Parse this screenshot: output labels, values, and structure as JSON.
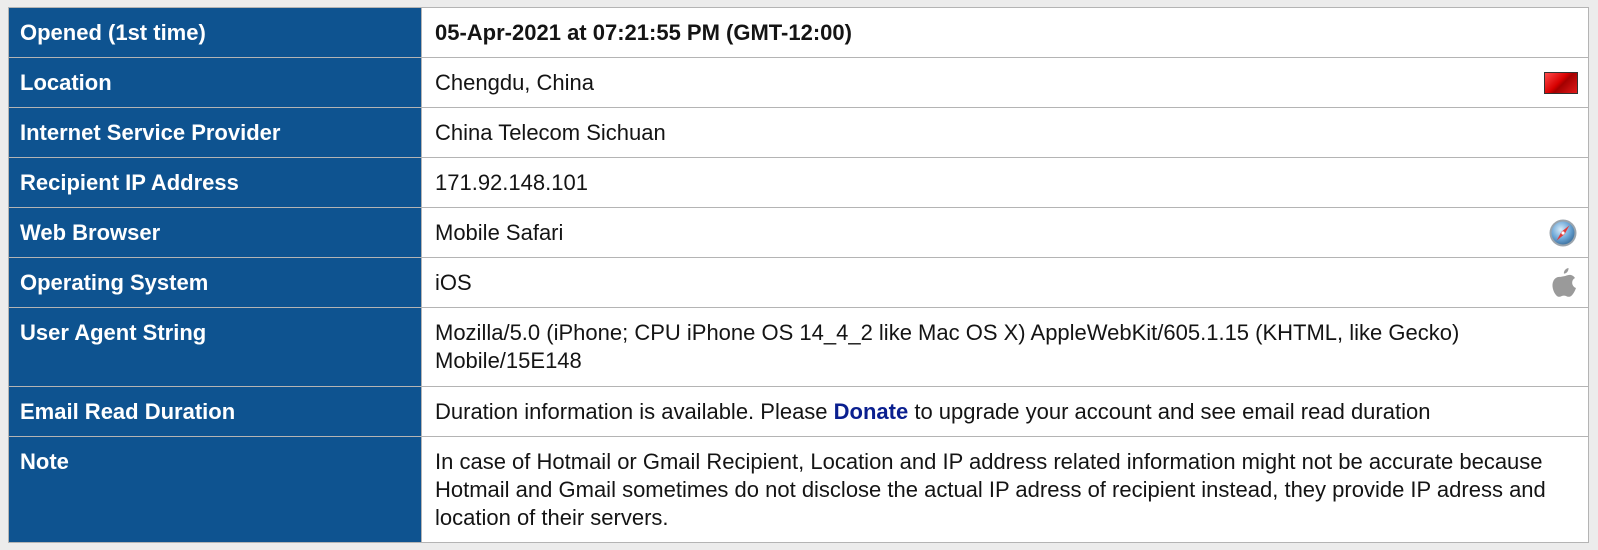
{
  "rows": {
    "opened": {
      "label": "Opened (1st time)",
      "value": "05-Apr-2021 at 07:21:55 PM (GMT-12:00)"
    },
    "location": {
      "label": "Location",
      "value": "Chengdu, China",
      "icon": "china-flag-icon"
    },
    "isp": {
      "label": "Internet Service Provider",
      "value": "China Telecom Sichuan"
    },
    "ip": {
      "label": "Recipient IP Address",
      "value": "171.92.148.101"
    },
    "browser": {
      "label": "Web Browser",
      "value": "Mobile Safari",
      "icon": "safari-icon"
    },
    "os": {
      "label": "Operating System",
      "value": "iOS",
      "icon": "apple-icon"
    },
    "user_agent": {
      "label": "User Agent String",
      "value": "Mozilla/5.0 (iPhone; CPU iPhone OS 14_4_2 like Mac OS X) AppleWebKit/605.1.15 (KHTML, like Gecko) Mobile/15E148"
    },
    "duration": {
      "label": "Email Read Duration",
      "value_before": "Duration information is available. Please ",
      "link_text": "Donate",
      "value_after": " to upgrade your account and see email read duration"
    },
    "note": {
      "label": "Note",
      "value": "In case of Hotmail or Gmail Recipient, Location and IP address related information might not be accurate because Hotmail and Gmail sometimes do not disclose the actual IP adress of recipient instead, they provide IP adress and location of their servers."
    }
  },
  "colors": {
    "label_background": "#0e5390",
    "label_text": "#ffffff",
    "link": "#0a1f8f",
    "border": "#b4b4b4"
  }
}
